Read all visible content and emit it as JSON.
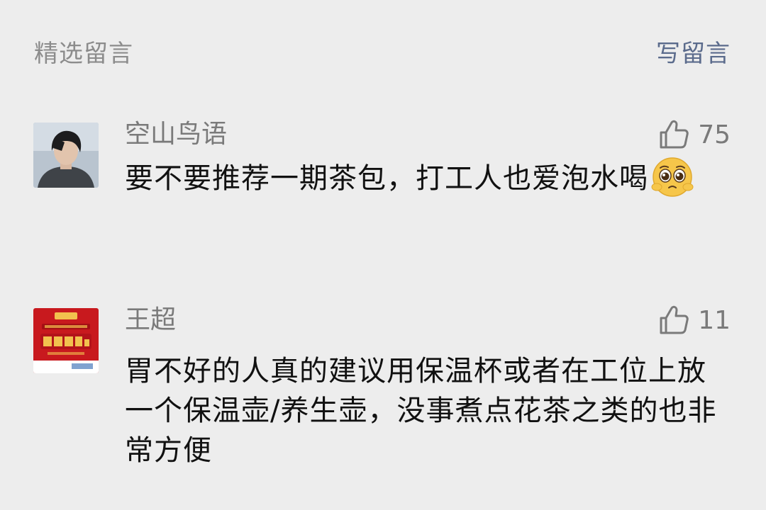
{
  "header": {
    "title": "精选留言",
    "write_label": "写留言"
  },
  "comments": [
    {
      "name": "空山鸟语",
      "likes": "75",
      "text": "要不要推荐一期茶包，打工人也爱泡水喝",
      "emoji": "pleading-face"
    },
    {
      "name": "王超",
      "likes": "11",
      "text": "胃不好的人真的建议用保温杯或者在工位上放一个保温壶/养生壶，没事煮点花茶之类的也非常方便"
    }
  ],
  "icons": {
    "like": "thumbs-up-icon"
  },
  "colors": {
    "background": "#ededed",
    "link": "#5b6b8c",
    "muted": "#7a7a7a",
    "avatar_red": "#c8191e"
  }
}
